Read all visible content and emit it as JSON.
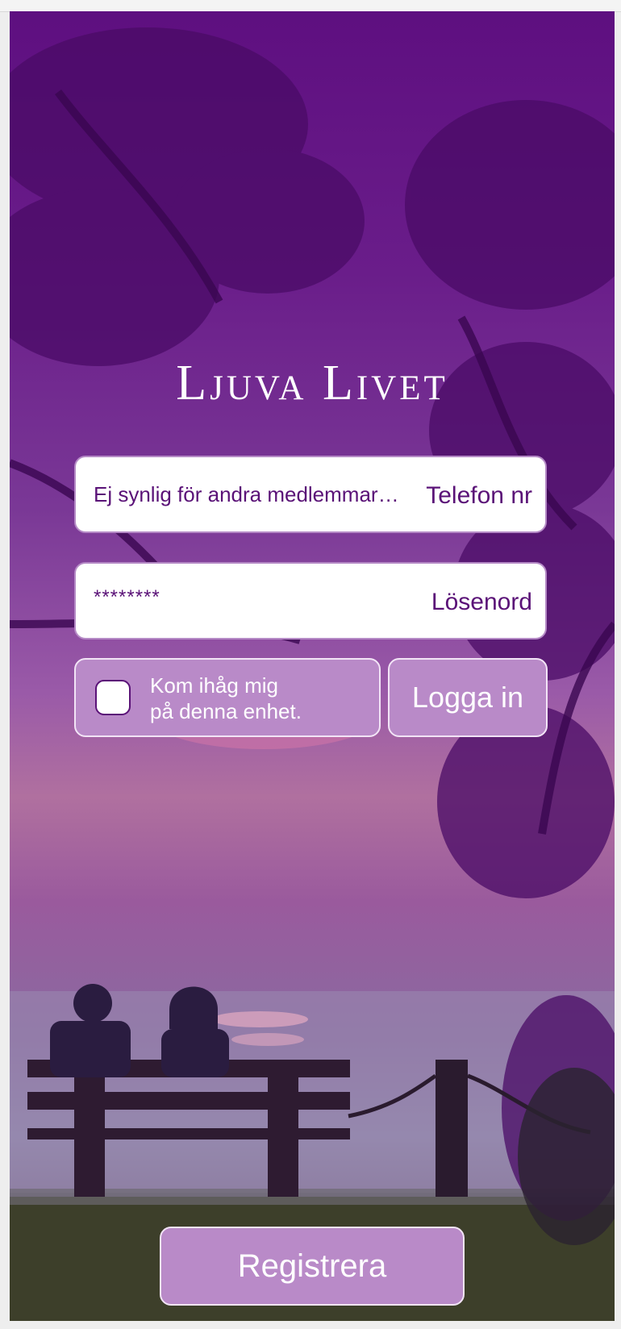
{
  "app": {
    "title": "Ljuva Livet"
  },
  "login": {
    "phone": {
      "value": "Ej synlig för andra medlemmar…",
      "label": "Telefon nr"
    },
    "password": {
      "value": "********",
      "label": "Lösenord"
    },
    "remember": {
      "line1": "Kom ihåg mig",
      "line2": "på denna enhet.",
      "checked": false
    },
    "login_button": "Logga in"
  },
  "register_button": "Registrera",
  "colors": {
    "primary": "#5a1277",
    "button": "#b98ac8",
    "background_top": "#5e0f80"
  },
  "background": {
    "scene": "sunset-couple-on-bench-photo"
  }
}
